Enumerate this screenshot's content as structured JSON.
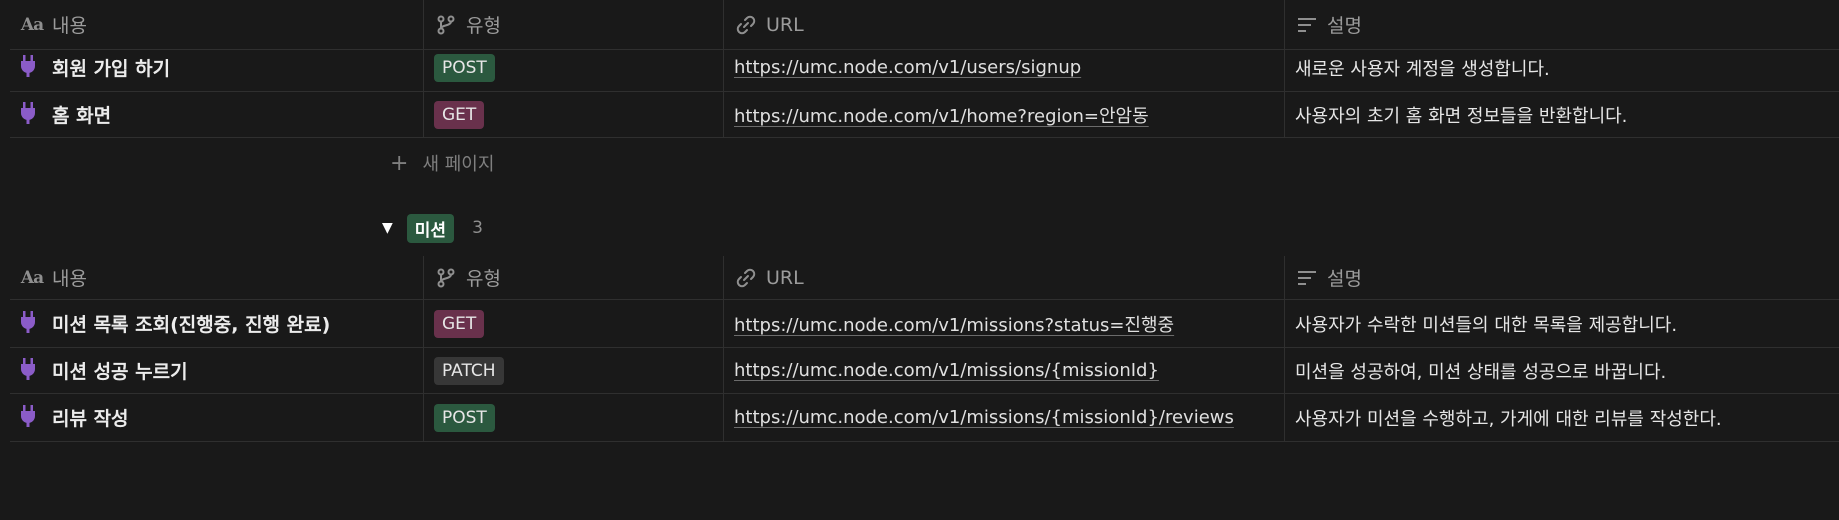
{
  "table1": {
    "headers": {
      "name": "내용",
      "type": "유형",
      "url": "URL",
      "desc": "설명"
    },
    "rows": [
      {
        "name": "회원 가입 하기",
        "type": "POST",
        "type_color": "#2b593f",
        "url": "https://umc.node.com/v1/users/signup",
        "desc": "새로운 사용자 계정을 생성합니다."
      },
      {
        "name": "홈 화면",
        "type": "GET",
        "type_color": "#69314c",
        "url": "https://umc.node.com/v1/home?region=안암동",
        "desc": "사용자의 초기 홈 화면 정보들을 반환합니다."
      }
    ],
    "new_page_label": "새 페이지"
  },
  "group": {
    "label": "미션",
    "count": "3",
    "color": "#2b593f"
  },
  "table2": {
    "headers": {
      "name": "내용",
      "type": "유형",
      "url": "URL",
      "desc": "설명"
    },
    "rows": [
      {
        "name": "미션 목록 조회(진행중, 진행 완료)",
        "type": "GET",
        "type_color": "#69314c",
        "url": "https://umc.node.com/v1/missions?status=진행중",
        "desc": "사용자가 수락한 미션들의 대한 목록을 제공합니다."
      },
      {
        "name": "미션 성공 누르기",
        "type": "PATCH",
        "type_color": "#373737",
        "url": "https://umc.node.com/v1/missions/{missionId}",
        "desc": "미션을 성공하여, 미션 상태를 성공으로 바꿉니다."
      },
      {
        "name": "리뷰 작성",
        "type": "POST",
        "type_color": "#2b593f",
        "url": "https://umc.node.com/v1/missions/{missionId}/reviews",
        "desc": "사용자가 미션을 수행하고, 가게에 대한 리뷰를 작성한다."
      }
    ]
  },
  "icons": {
    "title_prop": "title-aa-icon",
    "select_prop": "branch-icon",
    "url_prop": "link-icon",
    "text_prop": "text-lines-icon",
    "row_icon": "plug-icon"
  }
}
